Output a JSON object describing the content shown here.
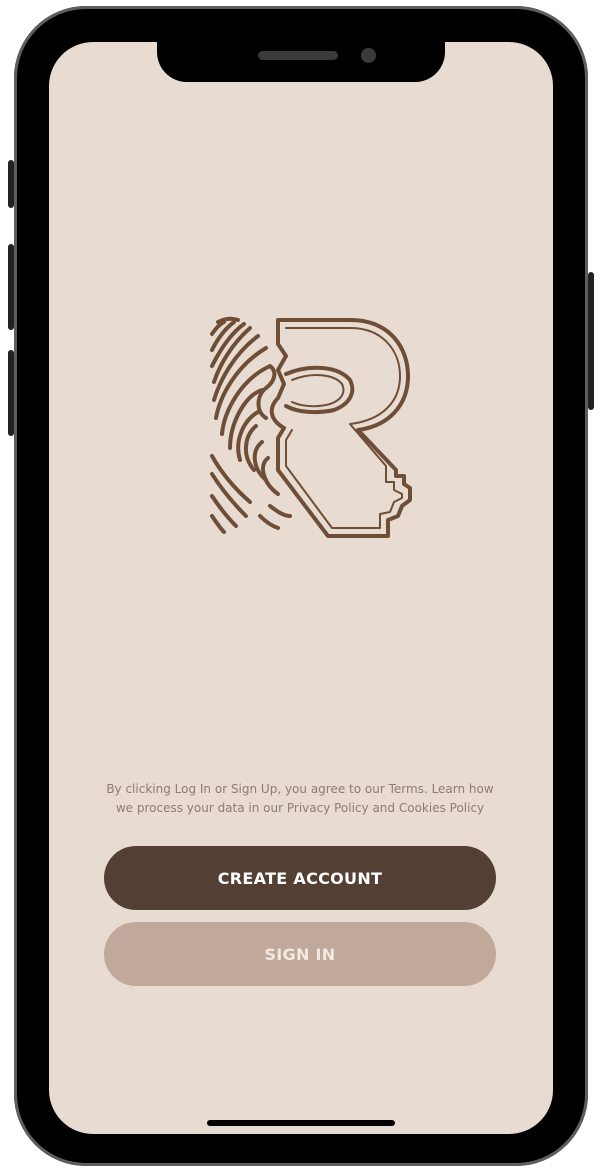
{
  "legal": {
    "line1": "By clicking Log In or Sign Up, you agree to our Terms. Learn how",
    "line2": "we process your data in our Privacy Policy and Cookies Policy"
  },
  "actions": {
    "create_account_label": "CREATE ACCOUNT",
    "sign_in_label": "SIGN IN"
  },
  "icons": {
    "logo": "r-fingerprint-key-logo"
  },
  "colors": {
    "background": "#e8dbd2",
    "brand_brown": "#533f33",
    "logo_brown": "#6e4e37",
    "secondary_button": "#c0a89a",
    "legal_text": "#8b7c74"
  }
}
